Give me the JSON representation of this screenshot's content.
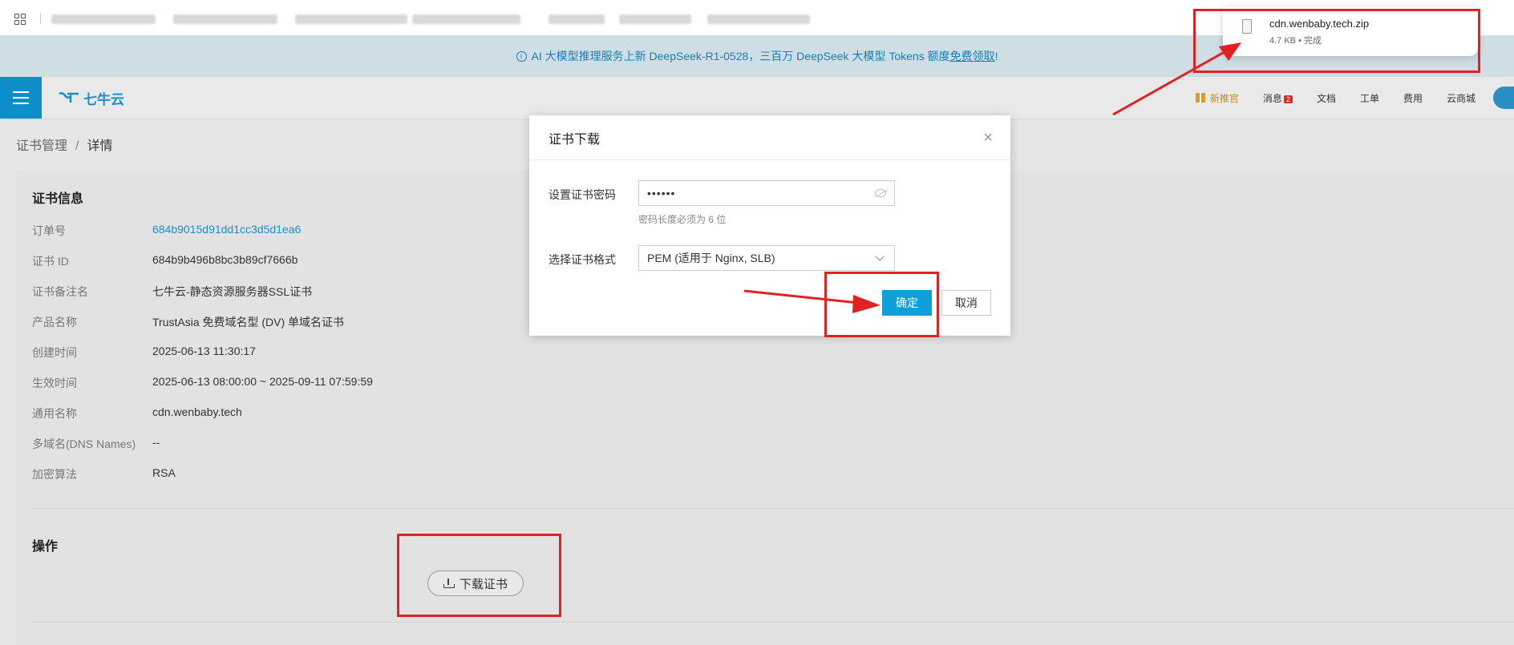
{
  "banner": {
    "text_main": "AI 大模型推理服务上新 DeepSeek-R1-0528，三百万 DeepSeek 大模型 Tokens 额度",
    "link_text": "免费领取",
    "suffix": "!"
  },
  "topnav": {
    "logo_text": "七牛云",
    "links": {
      "promo": "新推官",
      "messages": "消息",
      "messages_badge": "2",
      "docs": "文档",
      "tickets": "工单",
      "billing": "费用",
      "mall": "云商城"
    }
  },
  "breadcrumb": {
    "parent": "证书管理",
    "separator": "/",
    "current": "详情"
  },
  "cert_info": {
    "title": "证书信息",
    "rows": [
      {
        "k": "订单号",
        "v": "684b9015d91dd1cc3d5d1ea6"
      },
      {
        "k": "证书 ID",
        "v": "684b9b496b8bc3b89cf7666b"
      },
      {
        "k": "证书备注名",
        "v": "七牛云-静态资源服务器SSL证书"
      },
      {
        "k": "产品名称",
        "v": "TrustAsia 免费域名型 (DV) 单域名证书"
      },
      {
        "k": "创建时间",
        "v": "2025-06-13 11:30:17"
      },
      {
        "k": "生效时间",
        "v": "2025-06-13 08:00:00 ~ 2025-09-11 07:59:59"
      },
      {
        "k": "通用名称",
        "v": "cdn.wenbaby.tech"
      },
      {
        "k": "多域名(DNS Names)",
        "v": "--"
      },
      {
        "k": "加密算法",
        "v": "RSA"
      }
    ]
  },
  "operations": {
    "title": "操作",
    "download_label": "下载证书"
  },
  "modal": {
    "title": "证书下载",
    "password_label": "设置证书密码",
    "password_value": "••••••",
    "password_hint": "密码长度必须为 6 位",
    "format_label": "选择证书格式",
    "format_value": "PEM (适用于 Nginx, SLB)",
    "ok_label": "确定",
    "cancel_label": "取消",
    "close_glyph": "×"
  },
  "download_popup": {
    "file_name": "cdn.wenbaby.tech.zip",
    "meta": "4.7 KB • 完成"
  },
  "colors": {
    "accent": "#0fa0d8",
    "annotation": "#e02222"
  }
}
